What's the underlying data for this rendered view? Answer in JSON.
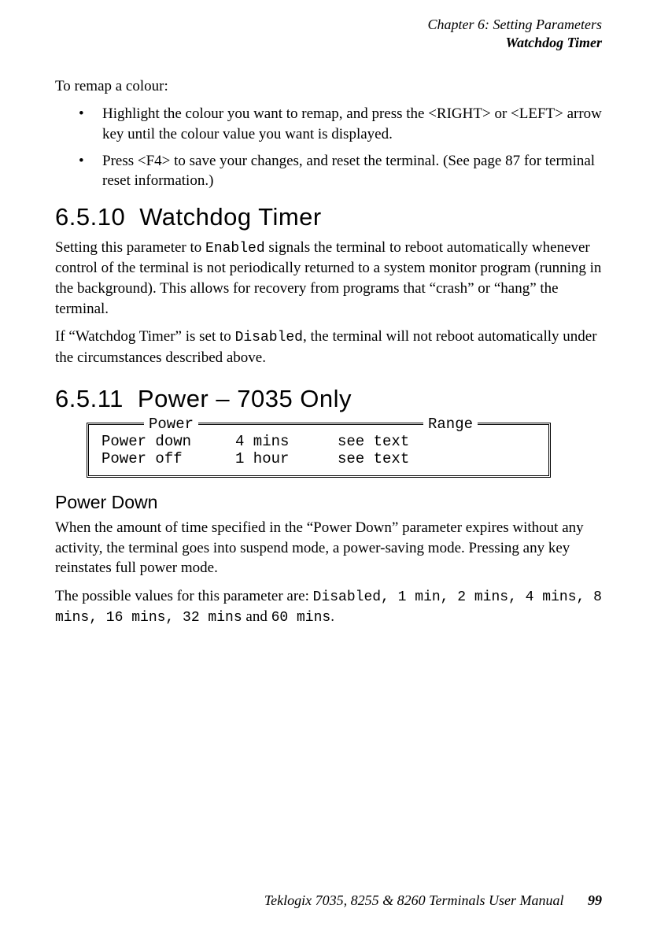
{
  "header": {
    "chapter": "Chapter 6: Setting Parameters",
    "section": "Watchdog Timer"
  },
  "intro": "To remap a colour:",
  "bullets": [
    "Highlight the colour you want to remap, and press the <RIGHT> or <LEFT> arrow key until the colour value you want is displayed.",
    "Press <F4> to save your changes, and reset the terminal. (See page 87 for terminal reset information.)"
  ],
  "s1": {
    "num": "6.5.10",
    "title": "Watchdog Timer",
    "p1a": "Setting this parameter to ",
    "p1_code": "Enabled",
    "p1b": " signals the terminal to reboot automatically whenever control of the terminal is not periodically returned to a system monitor program (running in the background). This allows for recovery from programs that “crash” or “hang” the terminal.",
    "p2a": "If “Watchdog Timer” is set to ",
    "p2_code": "Disabled",
    "p2b": ", the terminal will not reboot automatically under the circumstances described above."
  },
  "s2": {
    "num": "6.5.11",
    "title": "Power – 7035 Only",
    "panel": {
      "legend_left": "Power",
      "legend_right": "Range",
      "rows": [
        {
          "c1": "Power down",
          "c2": "4 mins",
          "c3": "see text"
        },
        {
          "c1": "Power off",
          "c2": "1 hour",
          "c3": "see text"
        }
      ]
    },
    "sub": "Power Down",
    "p1": "When the amount of time specified in the “Power Down” parameter expires without any activity, the terminal goes into suspend mode, a power-saving mode. Pressing any key reinstates full power mode.",
    "p2a": "The possible values for this parameter are: ",
    "p2_code1": "Disabled, 1 min, 2 mins, 4 mins, 8 mins, 16 mins, 32 mins",
    "p2b": " and ",
    "p2_code2": "60 mins",
    "p2c": "."
  },
  "footer": {
    "text": "Teklogix 7035, 8255 & 8260 Terminals User Manual",
    "page": "99"
  }
}
